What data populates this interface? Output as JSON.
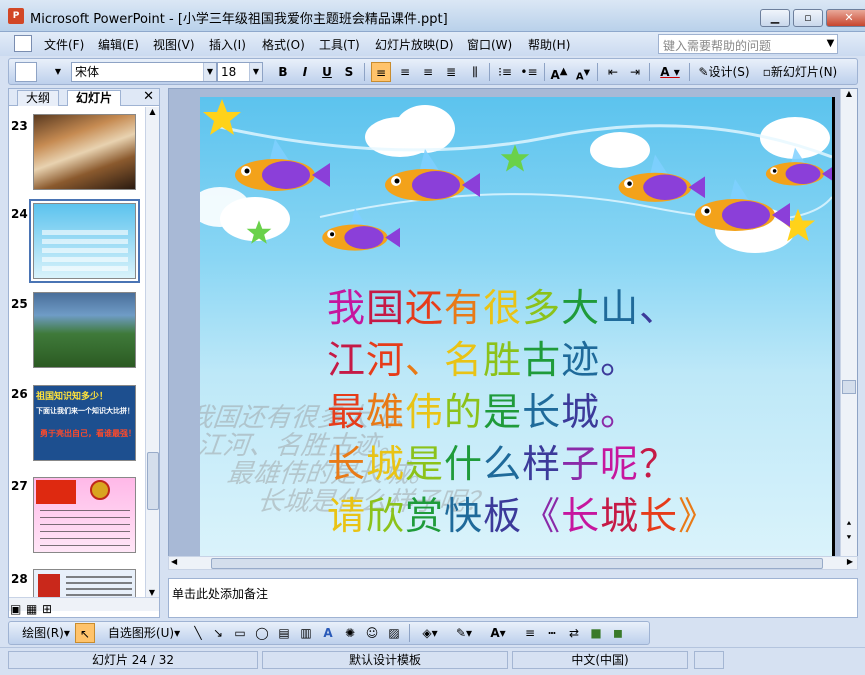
{
  "window": {
    "title": "Microsoft PowerPoint - [小学三年级祖国我爱你主题班会精品课件.ppt]"
  },
  "menu": [
    "文件(F)",
    "编辑(E)",
    "视图(V)",
    "插入(I)",
    "格式(O)",
    "工具(T)",
    "幻灯片放映(D)",
    "窗口(W)",
    "帮助(H)"
  ],
  "help_search": {
    "placeholder": "键入需要帮助的问题"
  },
  "toolbar": {
    "font": "宋体",
    "size": "18",
    "design_label": "设计(S)",
    "new_slide_label": "新幻灯片(N)"
  },
  "outline_tabs": [
    "大纲",
    "幻灯片"
  ],
  "slides_panel": [
    {
      "num": "23",
      "kind": "waterfall"
    },
    {
      "num": "24",
      "kind": "current",
      "selected": true
    },
    {
      "num": "25",
      "kind": "landscape"
    },
    {
      "num": "26",
      "kind": "quiz",
      "text1": "祖国知识知多少！",
      "text2": "下面让我们来一个知识大比拼！",
      "text3": "勇于亮出自己，看谁最强！"
    },
    {
      "num": "27",
      "kind": "emblem"
    },
    {
      "num": "28",
      "kind": "china-text"
    }
  ],
  "slide": {
    "lines": [
      [
        "我",
        "国",
        "还",
        "有",
        "很",
        "多",
        "大",
        "山",
        "、"
      ],
      [
        "江",
        "河",
        "、",
        "名",
        "胜",
        "古",
        "迹",
        "。"
      ],
      [
        "最",
        "雄",
        "伟",
        "的",
        "是",
        "长",
        "城",
        "。"
      ],
      [
        "长",
        "城",
        "是",
        "什",
        "么",
        "样",
        "子",
        "呢",
        "？"
      ],
      [
        "请",
        "欣",
        "赏",
        "快",
        "板",
        "《",
        "长",
        "城",
        "长",
        "》"
      ]
    ],
    "shadow_lines": [
      "我国还有很多大山、",
      "江河、名胜古迹。",
      "最雄伟的是长城。",
      "长城是什么样子呢？"
    ],
    "palette": [
      "#c6169e",
      "#c51a46",
      "#e63c1a",
      "#e87a17",
      "#e9c315",
      "#8cc21a",
      "#1f9b3a",
      "#1f6a9a",
      "#3c3a9a",
      "#8a2aa8"
    ]
  },
  "notes": {
    "placeholder": "单击此处添加备注"
  },
  "drawing": {
    "draw_label": "绘图(R)",
    "autoshape_label": "自选图形(U)"
  },
  "status": {
    "slide_count": "幻灯片 24 / 32",
    "template": "默认设计模板",
    "language": "中文(中国)"
  }
}
